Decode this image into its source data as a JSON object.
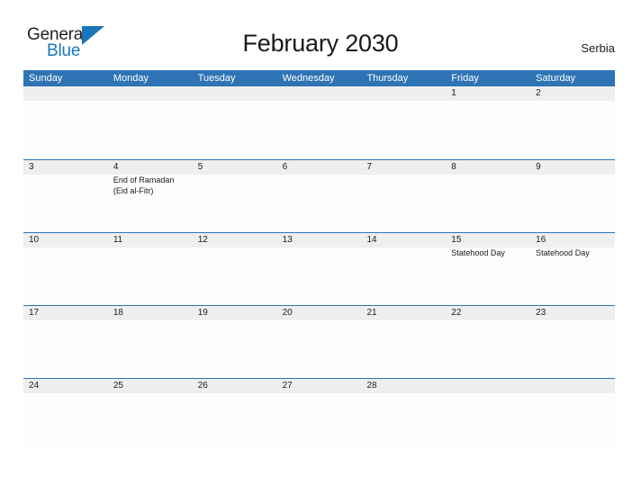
{
  "brand": {
    "name_part1": "General",
    "name_part2": "Blue",
    "flag_icon": "flag-triangle-icon",
    "accent_color": "#1b75bb"
  },
  "header": {
    "title": "February 2030",
    "region": "Serbia"
  },
  "calendar": {
    "header_color": "#2e74b5",
    "day_strip_color": "#efefef",
    "weekdays": [
      "Sunday",
      "Monday",
      "Tuesday",
      "Wednesday",
      "Thursday",
      "Friday",
      "Saturday"
    ],
    "weeks": [
      [
        {
          "day": "",
          "events": []
        },
        {
          "day": "",
          "events": []
        },
        {
          "day": "",
          "events": []
        },
        {
          "day": "",
          "events": []
        },
        {
          "day": "",
          "events": []
        },
        {
          "day": "1",
          "events": []
        },
        {
          "day": "2",
          "events": []
        }
      ],
      [
        {
          "day": "3",
          "events": []
        },
        {
          "day": "4",
          "events": [
            "End of Ramadan",
            "(Eid al-Fitr)"
          ]
        },
        {
          "day": "5",
          "events": []
        },
        {
          "day": "6",
          "events": []
        },
        {
          "day": "7",
          "events": []
        },
        {
          "day": "8",
          "events": []
        },
        {
          "day": "9",
          "events": []
        }
      ],
      [
        {
          "day": "10",
          "events": []
        },
        {
          "day": "11",
          "events": []
        },
        {
          "day": "12",
          "events": []
        },
        {
          "day": "13",
          "events": []
        },
        {
          "day": "14",
          "events": []
        },
        {
          "day": "15",
          "events": [
            "Statehood Day"
          ]
        },
        {
          "day": "16",
          "events": [
            "Statehood Day"
          ]
        }
      ],
      [
        {
          "day": "17",
          "events": []
        },
        {
          "day": "18",
          "events": []
        },
        {
          "day": "19",
          "events": []
        },
        {
          "day": "20",
          "events": []
        },
        {
          "day": "21",
          "events": []
        },
        {
          "day": "22",
          "events": []
        },
        {
          "day": "23",
          "events": []
        }
      ],
      [
        {
          "day": "24",
          "events": []
        },
        {
          "day": "25",
          "events": []
        },
        {
          "day": "26",
          "events": []
        },
        {
          "day": "27",
          "events": []
        },
        {
          "day": "28",
          "events": []
        },
        {
          "day": "",
          "events": []
        },
        {
          "day": "",
          "events": []
        }
      ]
    ]
  }
}
